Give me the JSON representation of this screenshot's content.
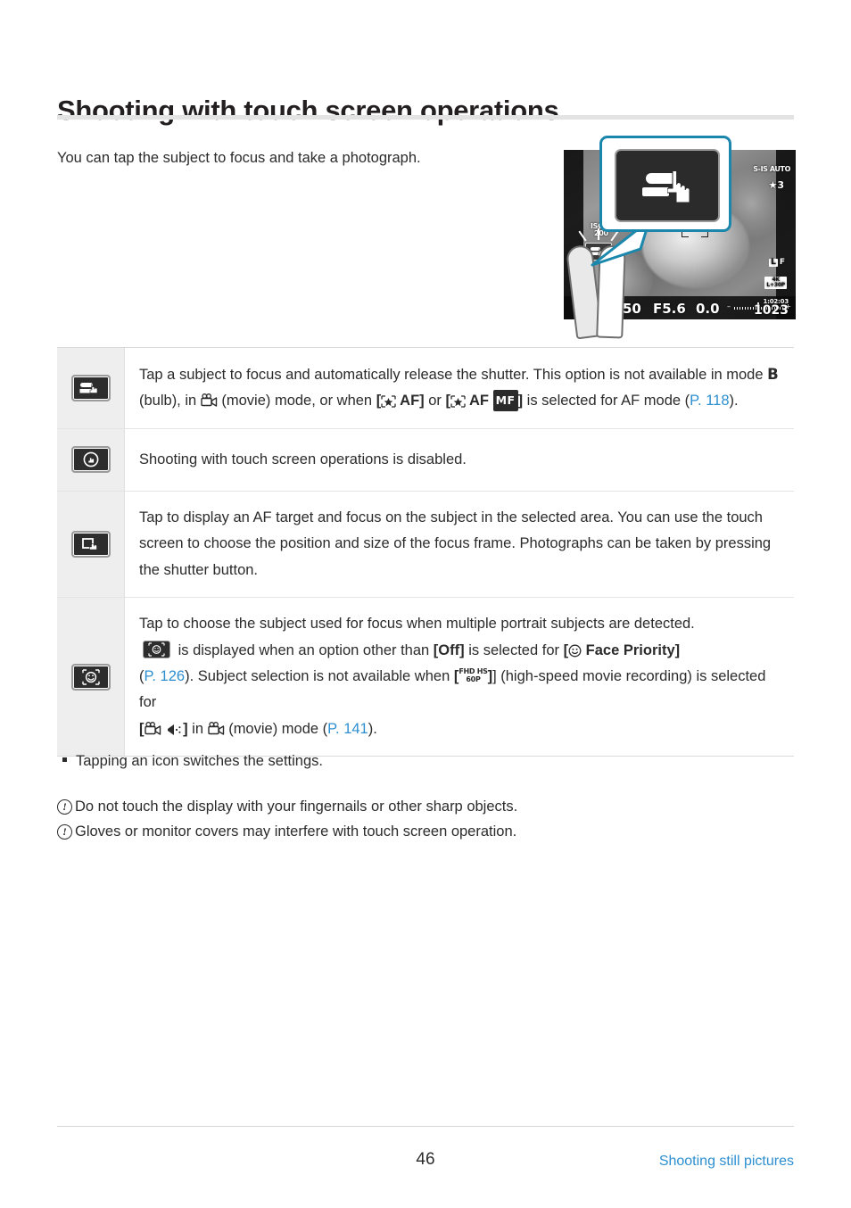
{
  "heading": "Shooting with touch screen operations",
  "intro": "You can tap the subject to focus and take a photograph.",
  "illustration": {
    "name": "camera-lcd-touch-shooting",
    "osd": {
      "stabilizer": "S-IS AUTO",
      "picture_mode": "3",
      "quality_size": "L",
      "quality_compression": "F",
      "movie_quality_line1": "4K",
      "movie_quality_line2": "L+30P",
      "iso_label": "ISO-A",
      "iso_value": "200",
      "shutter_speed": "50",
      "aperture": "F5.6",
      "exposure_comp": "0.0",
      "ev_minus": "–",
      "ev_plus": "+",
      "record_time": "1:02:03",
      "shots_remaining": "1023"
    },
    "callout_icon": "touch-shutter-icon"
  },
  "table": {
    "rows": [
      {
        "icon": "touch-shutter-icon",
        "parts": [
          {
            "t": "text",
            "v": "Tap a subject to focus and automatically release the shutter. This option is not available in mode "
          },
          {
            "t": "bold",
            "v": "B"
          },
          {
            "t": "text",
            "v": " (bulb), in "
          },
          {
            "t": "sym",
            "v": "movie-camera-icon"
          },
          {
            "t": "text",
            "v": " (movie) mode, or when "
          },
          {
            "t": "bold",
            "v": "[★ AF]"
          },
          {
            "t": "text",
            "v": " or "
          },
          {
            "t": "bold",
            "v": "[★ AF MF]"
          },
          {
            "t": "text",
            "v": " is selected for AF mode ("
          },
          {
            "t": "ref",
            "v": "P. 118"
          },
          {
            "t": "text",
            "v": ")."
          }
        ],
        "label_starry": "AF",
        "label_mf": "MF",
        "ref": "P. 118"
      },
      {
        "icon": "touch-disabled-icon",
        "text": "Shooting with touch screen operations is disabled."
      },
      {
        "icon": "touch-af-target-icon",
        "text": "Tap to display an AF target and focus on the subject in the selected area. You can use the touch screen to choose the position and size of the focus frame. Photographs can be taken by pressing the shutter button."
      },
      {
        "icon": "face-subject-select-icon",
        "segments": {
          "s1": "Tap to choose the subject used for focus when multiple portrait subjects are detected.",
          "s2a": " is displayed when an option other than ",
          "s2b": "[Off]",
          "s2c": " is selected for ",
          "s2d": "[☺ Face Priority]",
          "s3a": " (",
          "s3ref": "P. 126",
          "s3b": "). Subject selection is not available when ",
          "s3c": "[",
          "s3fhd1": "FHD HS",
          "s3fhd2": "60P",
          "s3d": "] (high-speed movie recording) is selected for ",
          "s3e": "[",
          "s3f": "]",
          "s3g": " in ",
          "s3h": " (movie) mode (",
          "s3ref2": "P. 141",
          "s3i": ")."
        }
      }
    ]
  },
  "tips": [
    "Tapping an icon switches the settings."
  ],
  "cautions": [
    "Do not touch the display with your fingernails or other sharp objects.",
    "Gloves or monitor covers may interfere with touch screen operation."
  ],
  "footer": {
    "page_number": "46",
    "section": "Shooting still pictures"
  },
  "colors": {
    "link": "#2d8fd0",
    "callout_border": "#1b87ad",
    "rule": "#e3e3e3",
    "icon_cell_bg": "#eeeeee"
  }
}
